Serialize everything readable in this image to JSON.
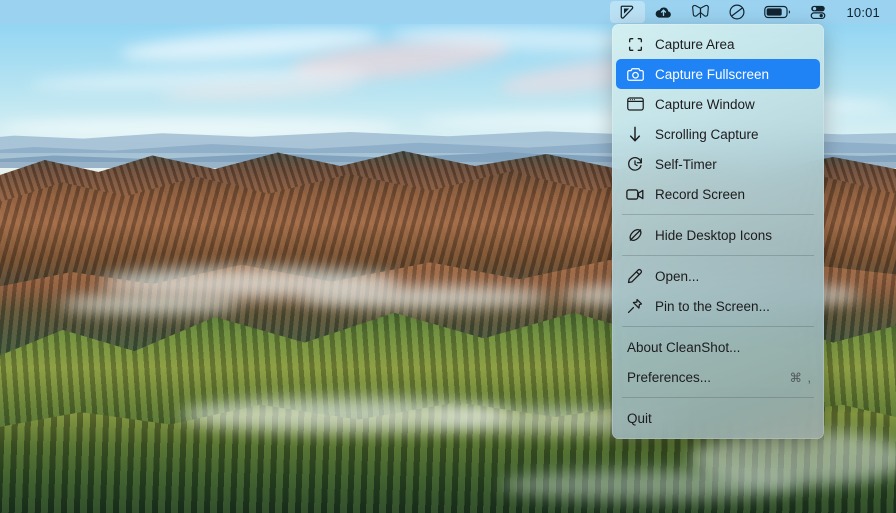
{
  "menubar": {
    "status_icons": [
      {
        "name": "cleanshot-icon",
        "active": true
      },
      {
        "name": "cloud-upload-icon",
        "active": false
      },
      {
        "name": "butterfly-icon",
        "active": false
      },
      {
        "name": "do-not-disturb-icon",
        "active": false
      },
      {
        "name": "battery-icon",
        "active": false
      },
      {
        "name": "control-center-icon",
        "active": false
      }
    ],
    "clock": "10:01"
  },
  "menu": {
    "app_name": "CleanShot",
    "highlight_color": "#1f82f5",
    "groups": [
      {
        "items": [
          {
            "icon": "capture-area-icon",
            "label": "Capture Area",
            "selected": false,
            "shortcut": ""
          },
          {
            "icon": "camera-icon",
            "label": "Capture Fullscreen",
            "selected": true,
            "shortcut": ""
          },
          {
            "icon": "window-icon",
            "label": "Capture Window",
            "selected": false,
            "shortcut": ""
          },
          {
            "icon": "scrolling-capture-icon",
            "label": "Scrolling Capture",
            "selected": false,
            "shortcut": ""
          },
          {
            "icon": "timer-icon",
            "label": "Self-Timer",
            "selected": false,
            "shortcut": ""
          },
          {
            "icon": "record-screen-icon",
            "label": "Record Screen",
            "selected": false,
            "shortcut": ""
          }
        ]
      },
      {
        "items": [
          {
            "icon": "hide-desktop-icons-icon",
            "label": "Hide Desktop Icons",
            "selected": false,
            "shortcut": ""
          }
        ]
      },
      {
        "items": [
          {
            "icon": "pen-icon",
            "label": "Open...",
            "selected": false,
            "shortcut": ""
          },
          {
            "icon": "pin-icon",
            "label": "Pin to the Screen...",
            "selected": false,
            "shortcut": ""
          }
        ]
      },
      {
        "items": [
          {
            "icon": "",
            "label": "About CleanShot...",
            "selected": false,
            "shortcut": ""
          },
          {
            "icon": "",
            "label": "Preferences...",
            "selected": false,
            "shortcut": "⌘ ,"
          }
        ]
      },
      {
        "items": [
          {
            "icon": "",
            "label": "Quit",
            "selected": false,
            "shortcut": ""
          }
        ]
      }
    ]
  }
}
